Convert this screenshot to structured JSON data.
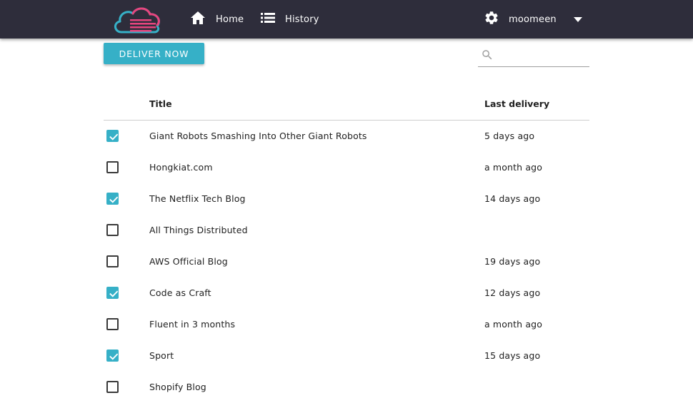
{
  "colors": {
    "topbar": "#2e2d3b",
    "accent": "#36b0c7",
    "logo_blue": "#36b0c7",
    "logo_pink": "#e8457e"
  },
  "header": {
    "logo_icon": "cloud-logo-icon",
    "nav": [
      {
        "label": "Home",
        "icon": "home-icon"
      },
      {
        "label": "History",
        "icon": "list-icon"
      }
    ],
    "user": {
      "name": "moomeen",
      "icon": "gear-icon",
      "menu_icon": "caret-down-icon"
    }
  },
  "toolbar": {
    "deliver_label": "DELIVER NOW",
    "search": {
      "placeholder": "",
      "value": "",
      "icon": "search-icon"
    }
  },
  "table": {
    "columns": {
      "title": "Title",
      "last_delivery": "Last delivery"
    },
    "rows": [
      {
        "checked": true,
        "title": "Giant Robots Smashing Into Other Giant Robots",
        "last_delivery": "5 days ago"
      },
      {
        "checked": false,
        "title": "Hongkiat.com",
        "last_delivery": "a month ago"
      },
      {
        "checked": true,
        "title": "The Netflix Tech Blog",
        "last_delivery": "14 days ago"
      },
      {
        "checked": false,
        "title": "All Things Distributed",
        "last_delivery": ""
      },
      {
        "checked": false,
        "title": "AWS Official Blog",
        "last_delivery": "19 days ago"
      },
      {
        "checked": true,
        "title": "Code as Craft",
        "last_delivery": "12 days ago"
      },
      {
        "checked": false,
        "title": "Fluent in 3 months",
        "last_delivery": "a month ago"
      },
      {
        "checked": true,
        "title": "Sport",
        "last_delivery": "15 days ago"
      },
      {
        "checked": false,
        "title": "Shopify Blog",
        "last_delivery": ""
      }
    ]
  }
}
